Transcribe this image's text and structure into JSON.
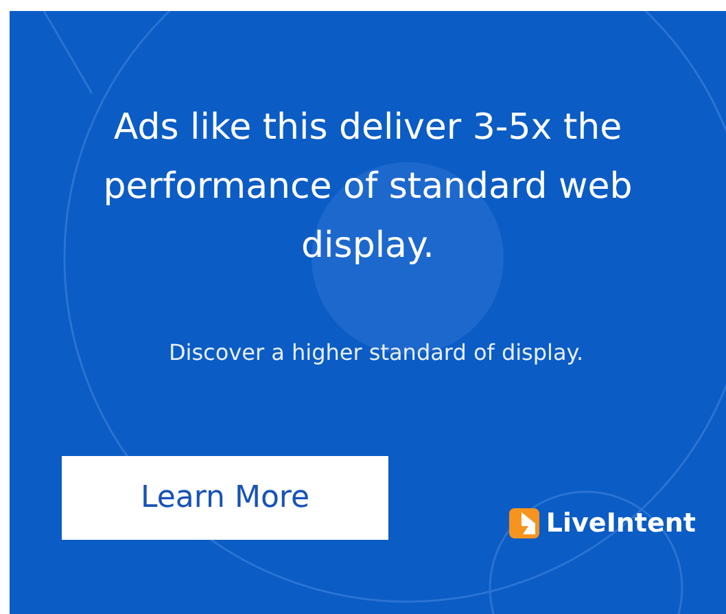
{
  "ad": {
    "headline": "Ads like this deliver 3-5x the performance of standard web display.",
    "subtext": "Discover a higher standard of display.",
    "button": "Learn More",
    "brand": "LiveIntent"
  }
}
